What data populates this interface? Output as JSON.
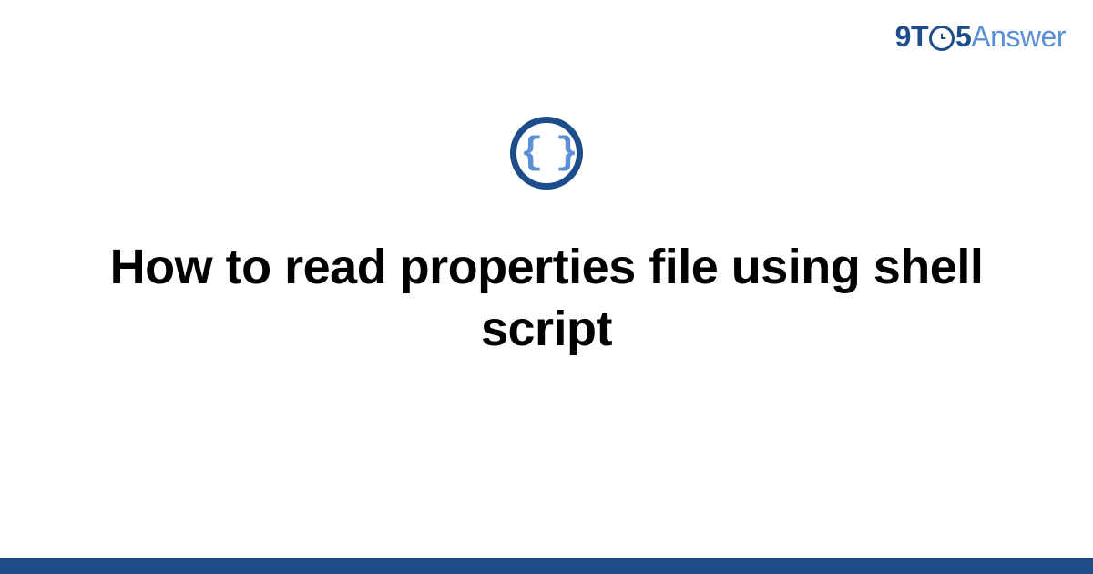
{
  "logo": {
    "part1": "9T",
    "clock": "⏱",
    "part2": "5",
    "part3": "Answer"
  },
  "icon": {
    "symbol": "{ }"
  },
  "title": "How to read properties file using shell script"
}
